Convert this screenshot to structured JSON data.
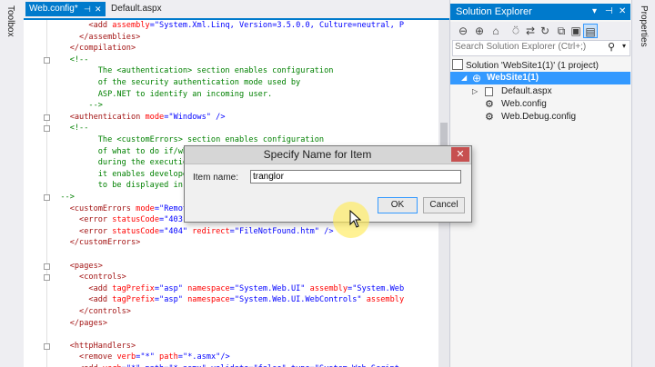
{
  "toolbox": {
    "label": "Toolbox"
  },
  "tabs": [
    {
      "label": "Web.config*",
      "active": true
    },
    {
      "label": "Default.aspx",
      "active": false
    }
  ],
  "editor": {
    "lines": [
      [
        [
          "        ",
          ""
        ],
        [
          "<add ",
          "xml"
        ],
        [
          "assembly",
          "at"
        ],
        [
          "=",
          "pu"
        ],
        [
          "\"System.Xml.Linq, Version=3.5.0.0, Culture=neutral, P",
          "av"
        ]
      ],
      [
        [
          "      ",
          ""
        ],
        [
          "</assemblies>",
          "xml"
        ]
      ],
      [
        [
          "    ",
          ""
        ],
        [
          "</compilation>",
          "xml"
        ]
      ],
      [
        [
          "    ",
          ""
        ],
        [
          "<!--",
          "cm"
        ]
      ],
      [
        [
          "          The <authentication> section enables configuration",
          "cm"
        ]
      ],
      [
        [
          "          of the security authentication mode used by",
          "cm"
        ]
      ],
      [
        [
          "          ASP.NET to identify an incoming user.",
          "cm"
        ]
      ],
      [
        [
          "        -->",
          "cm"
        ]
      ],
      [
        [
          "    ",
          ""
        ],
        [
          "<authentication ",
          "xml"
        ],
        [
          "mode",
          "at"
        ],
        [
          "=",
          "pu"
        ],
        [
          "\"Windows\"",
          "av"
        ],
        [
          " />",
          "pu"
        ]
      ],
      [
        [
          "    ",
          ""
        ],
        [
          "<!--",
          "cm"
        ]
      ],
      [
        [
          "          The <customErrors> section enables configuration",
          "cm"
        ]
      ],
      [
        [
          "          of what to do if/when an unhandled error occurs",
          "cm"
        ]
      ],
      [
        [
          "          during the execution of a request. Specifically,",
          "cm"
        ]
      ],
      [
        [
          "          it enables developers to configure html error pages",
          "cm"
        ]
      ],
      [
        [
          "          to be displayed in place of a error stack trace.",
          "cm"
        ]
      ],
      [
        [
          "  -->",
          "cm"
        ]
      ],
      [
        [
          "    ",
          ""
        ],
        [
          "<customErrors ",
          "xml"
        ],
        [
          "mode",
          "at"
        ],
        [
          "=",
          "pu"
        ],
        [
          "\"RemoteOnly\" defaultRedirect=\"GenericErrorPage.htm\"",
          "av"
        ],
        [
          ">",
          "pu"
        ]
      ],
      [
        [
          "      ",
          ""
        ],
        [
          "<error ",
          "xml"
        ],
        [
          "statusCode",
          "at"
        ],
        [
          "=",
          "pu"
        ],
        [
          "\"403\" redirect=\"NoAccess.htm\"",
          "av"
        ],
        [
          " />",
          "pu"
        ]
      ],
      [
        [
          "      ",
          ""
        ],
        [
          "<error ",
          "xml"
        ],
        [
          "statusCode",
          "at"
        ],
        [
          "=",
          "pu"
        ],
        [
          "\"404\"",
          "av"
        ],
        [
          " redirect",
          "at"
        ],
        [
          "=",
          "pu"
        ],
        [
          "\"FileNotFound.htm\"",
          "av"
        ],
        [
          " />",
          "pu"
        ]
      ],
      [
        [
          "    ",
          ""
        ],
        [
          "</customErrors>",
          "xml"
        ]
      ],
      [
        [
          "",
          ""
        ]
      ],
      [
        [
          "    ",
          ""
        ],
        [
          "<pages>",
          "xml"
        ]
      ],
      [
        [
          "      ",
          ""
        ],
        [
          "<controls>",
          "xml"
        ]
      ],
      [
        [
          "        ",
          ""
        ],
        [
          "<add ",
          "xml"
        ],
        [
          "tagPrefix",
          "at"
        ],
        [
          "=",
          "pu"
        ],
        [
          "\"asp\"",
          "av"
        ],
        [
          " namespace",
          "at"
        ],
        [
          "=",
          "pu"
        ],
        [
          "\"System.Web.UI\"",
          "av"
        ],
        [
          " assembly",
          "at"
        ],
        [
          "=",
          "pu"
        ],
        [
          "\"System.Web",
          "av"
        ]
      ],
      [
        [
          "        ",
          ""
        ],
        [
          "<add ",
          "xml"
        ],
        [
          "tagPrefix",
          "at"
        ],
        [
          "=",
          "pu"
        ],
        [
          "\"asp\"",
          "av"
        ],
        [
          " namespace",
          "at"
        ],
        [
          "=",
          "pu"
        ],
        [
          "\"System.Web.UI.WebControls\"",
          "av"
        ],
        [
          " assembly",
          "at"
        ]
      ],
      [
        [
          "      ",
          ""
        ],
        [
          "</controls>",
          "xml"
        ]
      ],
      [
        [
          "    ",
          ""
        ],
        [
          "</pages>",
          "xml"
        ]
      ],
      [
        [
          "",
          ""
        ]
      ],
      [
        [
          "    ",
          ""
        ],
        [
          "<httpHandlers>",
          "xml"
        ]
      ],
      [
        [
          "      ",
          ""
        ],
        [
          "<remove ",
          "xml"
        ],
        [
          "verb",
          "at"
        ],
        [
          "=",
          "pu"
        ],
        [
          "\"*\"",
          "av"
        ],
        [
          " path",
          "at"
        ],
        [
          "=",
          "pu"
        ],
        [
          "\"*.asmx\"",
          "av"
        ],
        [
          "/>",
          "pu"
        ]
      ],
      [
        [
          "      ",
          ""
        ],
        [
          "<add ",
          "xml"
        ],
        [
          "verb",
          "at"
        ],
        [
          "=",
          "pu"
        ],
        [
          "\"*\" path=\"*.asmx\" validate=\"false\" type=\"System.Web.Script",
          "av"
        ]
      ]
    ]
  },
  "solution_explorer": {
    "title": "Solution Explorer",
    "search_placeholder": "Search Solution Explorer (Ctrl+;)",
    "tree": [
      {
        "label": "Solution 'WebSite1(1)' (1 project)",
        "level": 0,
        "selected": false
      },
      {
        "label": "WebSite1(1)",
        "level": 1,
        "selected": true
      },
      {
        "label": "Default.aspx",
        "level": 2,
        "selected": false
      },
      {
        "label": "Web.config",
        "level": 2,
        "selected": false
      },
      {
        "label": "Web.Debug.config",
        "level": 2,
        "selected": false
      }
    ]
  },
  "properties": {
    "label": "Properties"
  },
  "dialog": {
    "title": "Specify Name for Item",
    "field_label": "Item name:",
    "field_value": "tranglor",
    "ok_label": "OK",
    "cancel_label": "Cancel"
  },
  "colors": {
    "accent": "#007acc",
    "selection": "#3399ff",
    "close": "#c75050"
  }
}
